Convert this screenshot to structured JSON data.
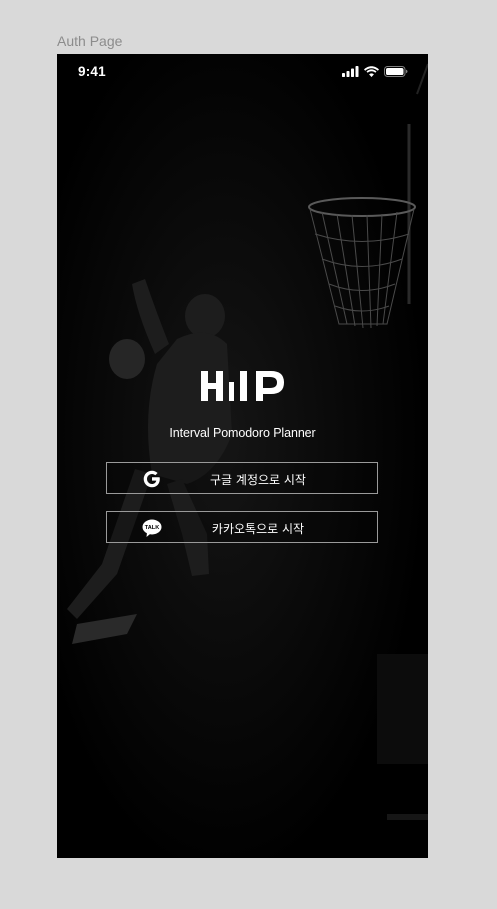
{
  "frame": {
    "label": "Auth Page"
  },
  "status_bar": {
    "time": "9:41"
  },
  "brand": {
    "logo_text": "HilP",
    "subtitle": "Interval Pomodoro Planner"
  },
  "auth": {
    "google_label": "구글 계정으로 시작",
    "kakao_label": "카카오톡으로 시작",
    "kakao_badge": "TALK"
  },
  "colors": {
    "page_background": "#d9d9d9",
    "screen_background": "#000000",
    "button_border": "#9a9a9a",
    "text": "#ffffff"
  },
  "icons": {
    "google": "google-g-icon",
    "kakao": "kakao-talk-icon",
    "signal": "cellular-signal-icon",
    "wifi": "wifi-icon",
    "battery": "battery-icon"
  }
}
